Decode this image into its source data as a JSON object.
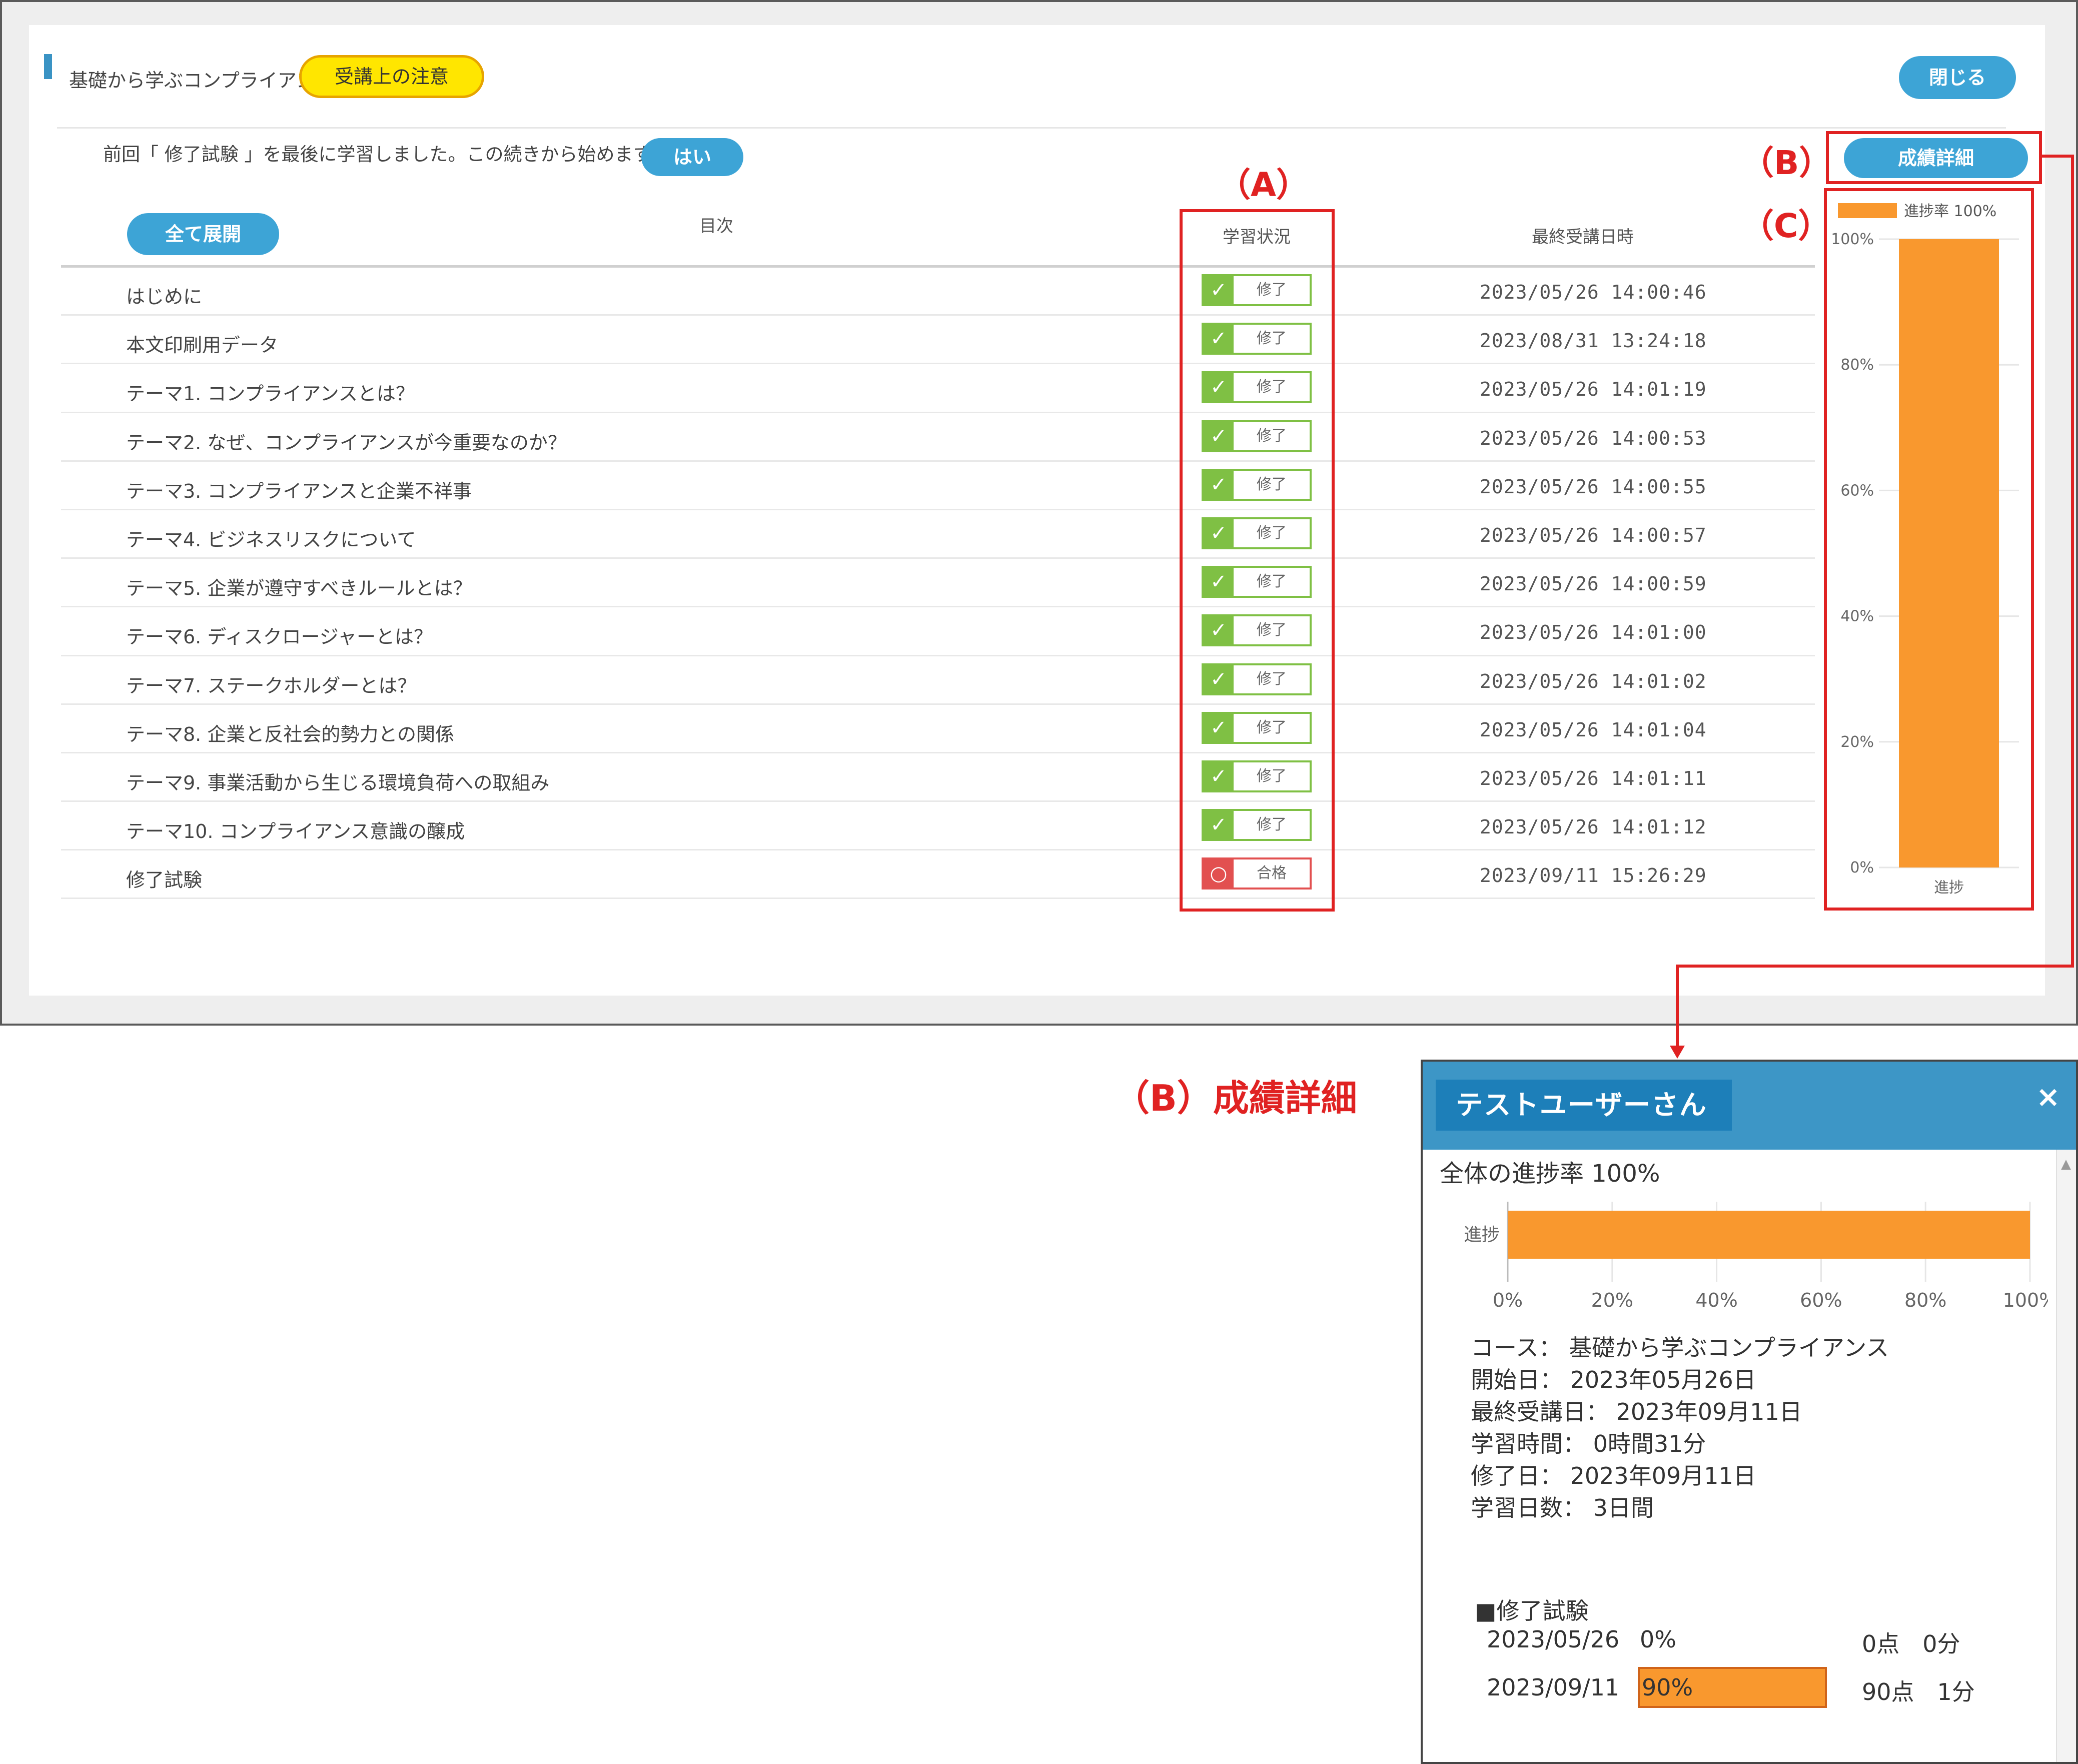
{
  "header": {
    "course_title": "基礎から学ぶコンプライアンス",
    "notice_button": "受講上の注意",
    "close_button": "閉じる"
  },
  "resume": {
    "message": "前回「 修了試験 」を最後に学習しました。この続きから始めますか？",
    "yes_button": "はい"
  },
  "grade_detail_button": "成績詳細",
  "callouts": {
    "a": "（A）",
    "b": "（B）",
    "c": "（C）",
    "b_detail": "（B）成績詳細"
  },
  "table": {
    "expand_all_button": "全て展開",
    "col_toc": "目次",
    "col_status": "学習状況",
    "col_last_date": "最終受講日時",
    "rows": [
      {
        "title": "はじめに",
        "status": "修了",
        "date": "2023/05/26 14:00:46"
      },
      {
        "title": "本文印刷用データ",
        "status": "修了",
        "date": "2023/08/31 13:24:18"
      },
      {
        "title": "テーマ1. コンプライアンスとは？",
        "status": "修了",
        "date": "2023/05/26 14:01:19"
      },
      {
        "title": "テーマ2. なぜ、コンプライアンスが今重要なのか？",
        "status": "修了",
        "date": "2023/05/26 14:00:53"
      },
      {
        "title": "テーマ3. コンプライアンスと企業不祥事",
        "status": "修了",
        "date": "2023/05/26 14:00:55"
      },
      {
        "title": "テーマ4. ビジネスリスクについて",
        "status": "修了",
        "date": "2023/05/26 14:00:57"
      },
      {
        "title": "テーマ5. 企業が遵守すべきルールとは？",
        "status": "修了",
        "date": "2023/05/26 14:00:59"
      },
      {
        "title": "テーマ6. ディスクロージャーとは？",
        "status": "修了",
        "date": "2023/05/26 14:01:00"
      },
      {
        "title": "テーマ7. ステークホルダーとは？",
        "status": "修了",
        "date": "2023/05/26 14:01:02"
      },
      {
        "title": "テーマ8. 企業と反社会的勢力との関係",
        "status": "修了",
        "date": "2023/05/26 14:01:04"
      },
      {
        "title": "テーマ9. 事業活動から生じる環境負荷への取組み",
        "status": "修了",
        "date": "2023/05/26 14:01:11"
      },
      {
        "title": "テーマ10. コンプライアンス意識の醸成",
        "status": "修了",
        "date": "2023/05/26 14:01:12"
      },
      {
        "title": "修了試験",
        "status": "合格",
        "date": "2023/09/11 15:26:29"
      }
    ]
  },
  "icons": {
    "check": "check-icon",
    "pass": "circle-icon",
    "close": "close-icon",
    "scroll_up": "triangle-up-icon"
  },
  "colors": {
    "accent_blue": "#3da4d6",
    "done_green": "#7fc044",
    "pass_red": "#e25050",
    "progress_orange": "#f9982e",
    "callout_red": "#e02222",
    "notice_yellow": "#ffe600"
  },
  "modal": {
    "user_name": "テストユーザーさん",
    "close_label": "×",
    "overall_progress": "全体の進捗率 100%",
    "course": "コース： 基礎から学ぶコンプライアンス",
    "start_date": "開始日： 2023年05月26日",
    "last_date": "最終受講日： 2023年09月11日",
    "study_time": "学習時間： 0時間31分",
    "completion_date": "修了日： 2023年09月11日",
    "study_days": "学習日数： 3日間",
    "exam_heading": "■修了試験",
    "exams": [
      {
        "date": "2023/05/26",
        "rate": "0%",
        "score": "0点　0分",
        "rate_value": 0
      },
      {
        "date": "2023/09/11",
        "rate": "90%",
        "score": "90点　1分",
        "rate_value": 90
      }
    ]
  },
  "chart_data": [
    {
      "type": "bar",
      "orientation": "vertical",
      "categories": [
        "進捗"
      ],
      "values": [
        100
      ],
      "legend": "進捗率 100%",
      "legend_position": "top",
      "ylim": [
        0,
        100
      ],
      "yticks": [
        "0%",
        "20%",
        "40%",
        "60%",
        "80%",
        "100%"
      ],
      "grid": true,
      "color": "#f9982e"
    },
    {
      "type": "bar",
      "orientation": "horizontal",
      "categories": [
        "進捗"
      ],
      "values": [
        100
      ],
      "xlim": [
        0,
        100
      ],
      "xticks": [
        "0%",
        "20%",
        "40%",
        "60%",
        "80%",
        "100%"
      ],
      "grid": true,
      "color": "#f9982e"
    }
  ]
}
